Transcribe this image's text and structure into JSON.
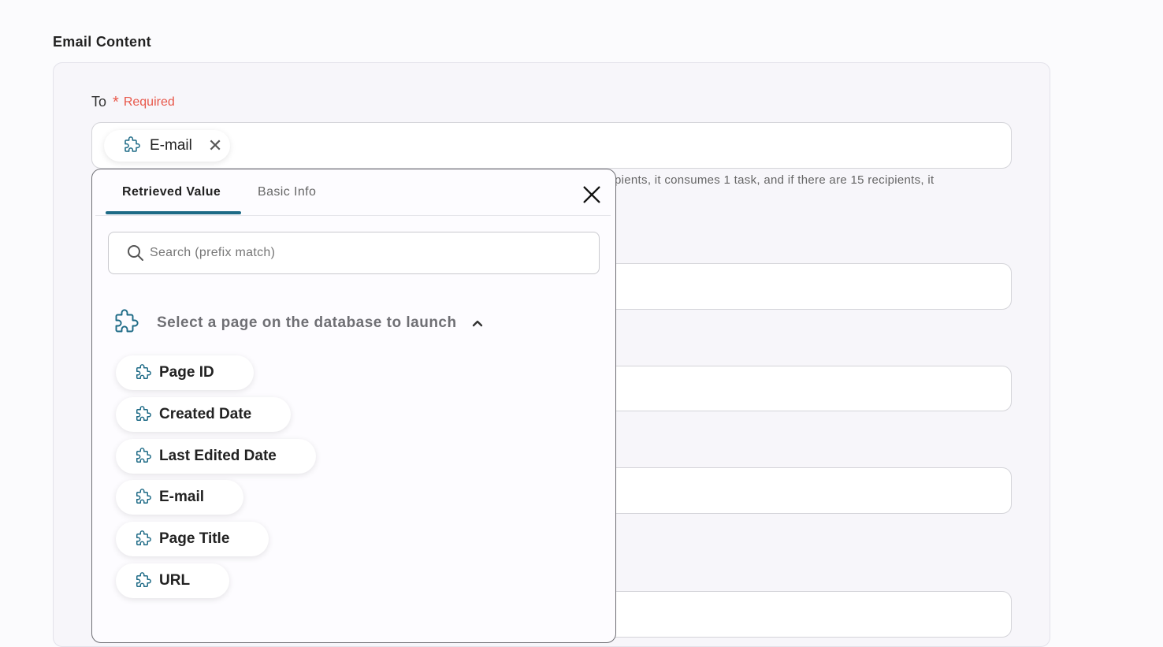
{
  "section": {
    "title": "Email Content"
  },
  "to_field": {
    "label": "To",
    "required_star": "*",
    "required_text": "Required",
    "chip_label": "E-mail",
    "chip_close": "✕"
  },
  "helper_text": "pients, it consumes 1 task, and if there are 15 recipients, it",
  "popup": {
    "tabs": [
      "Retrieved Value",
      "Basic Info"
    ],
    "active_tab": "Retrieved Value",
    "search_placeholder": "Search (prefix match)",
    "group_label": "Select a page on the database to launch",
    "items": [
      "Page ID",
      "Created Date",
      "Last Edited Date",
      "E-mail",
      "Page Title",
      "URL"
    ]
  },
  "icons": {
    "chip_icon": "puzzle-icon",
    "search": "search-icon",
    "close": "close-icon",
    "collapse": "chevron-up-icon"
  },
  "colors": {
    "accent": "#1d6a86",
    "required": "#e8584a",
    "puzzle_icon": "#1d6a86"
  }
}
